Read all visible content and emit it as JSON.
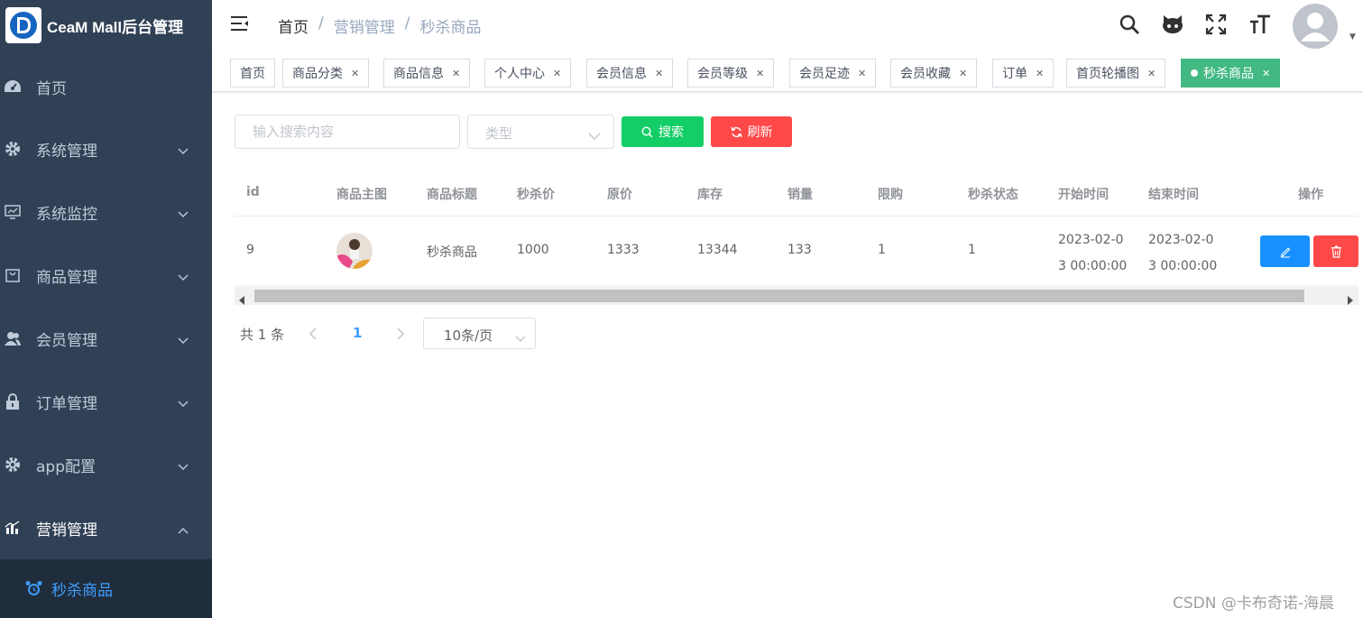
{
  "app": {
    "logo_text": "CeaM Mall后台管理"
  },
  "sidebar": {
    "items": [
      {
        "label": "首页",
        "icon": "dashboard-icon"
      },
      {
        "label": "系统管理",
        "icon": "gear-icon"
      },
      {
        "label": "系统监控",
        "icon": "monitor-icon"
      },
      {
        "label": "商品管理",
        "icon": "shopping-bag-icon"
      },
      {
        "label": "会员管理",
        "icon": "users-icon"
      },
      {
        "label": "订单管理",
        "icon": "lock-icon"
      },
      {
        "label": "app配置",
        "icon": "gear-icon"
      },
      {
        "label": "营销管理",
        "icon": "chart-icon"
      }
    ],
    "active_sub": {
      "label": "秒杀商品",
      "icon": "alarm-clock-icon"
    },
    "colors": {
      "bg": "#304156",
      "sub_bg": "#1f2d3d",
      "active_text": "#409eff"
    }
  },
  "header": {
    "breadcrumb": [
      "首页",
      "营销管理",
      "秒杀商品"
    ],
    "separator": "/",
    "icons": [
      "search-icon",
      "github-icon",
      "fullscreen-icon",
      "font-size-icon",
      "avatar"
    ]
  },
  "tags": [
    {
      "label": "首页",
      "closable": false
    },
    {
      "label": "商品分类",
      "closable": true
    },
    {
      "label": "商品信息",
      "closable": true
    },
    {
      "label": "个人中心",
      "closable": true
    },
    {
      "label": "会员信息",
      "closable": true
    },
    {
      "label": "会员等级",
      "closable": true
    },
    {
      "label": "会员足迹",
      "closable": true
    },
    {
      "label": "会员收藏",
      "closable": true
    },
    {
      "label": "订单",
      "closable": true
    },
    {
      "label": "首页轮播图",
      "closable": true
    },
    {
      "label": "秒杀商品",
      "closable": true,
      "active": true
    }
  ],
  "toolbar": {
    "search_placeholder": "输入搜索内容",
    "type_placeholder": "类型",
    "search_label": "搜索",
    "refresh_label": "刷新"
  },
  "table": {
    "columns": [
      "id",
      "商品主图",
      "商品标题",
      "秒杀价",
      "原价",
      "库存",
      "销量",
      "限购",
      "秒杀状态",
      "开始时间",
      "结束时间",
      "操作"
    ],
    "rows": [
      {
        "id": "9",
        "title": "秒杀商品",
        "seckill_price": "1000",
        "original_price": "1333",
        "stock": "13344",
        "sales": "133",
        "limit": "1",
        "status": "1",
        "start_time": "2023-02-03 00:00:00",
        "end_time": "2023-02-03 00:00:00"
      }
    ]
  },
  "pagination": {
    "total_text": "共 1 条",
    "current_page": "1",
    "page_size": "10条/页"
  },
  "watermark": "CSDN @卡布奇诺-海晨"
}
